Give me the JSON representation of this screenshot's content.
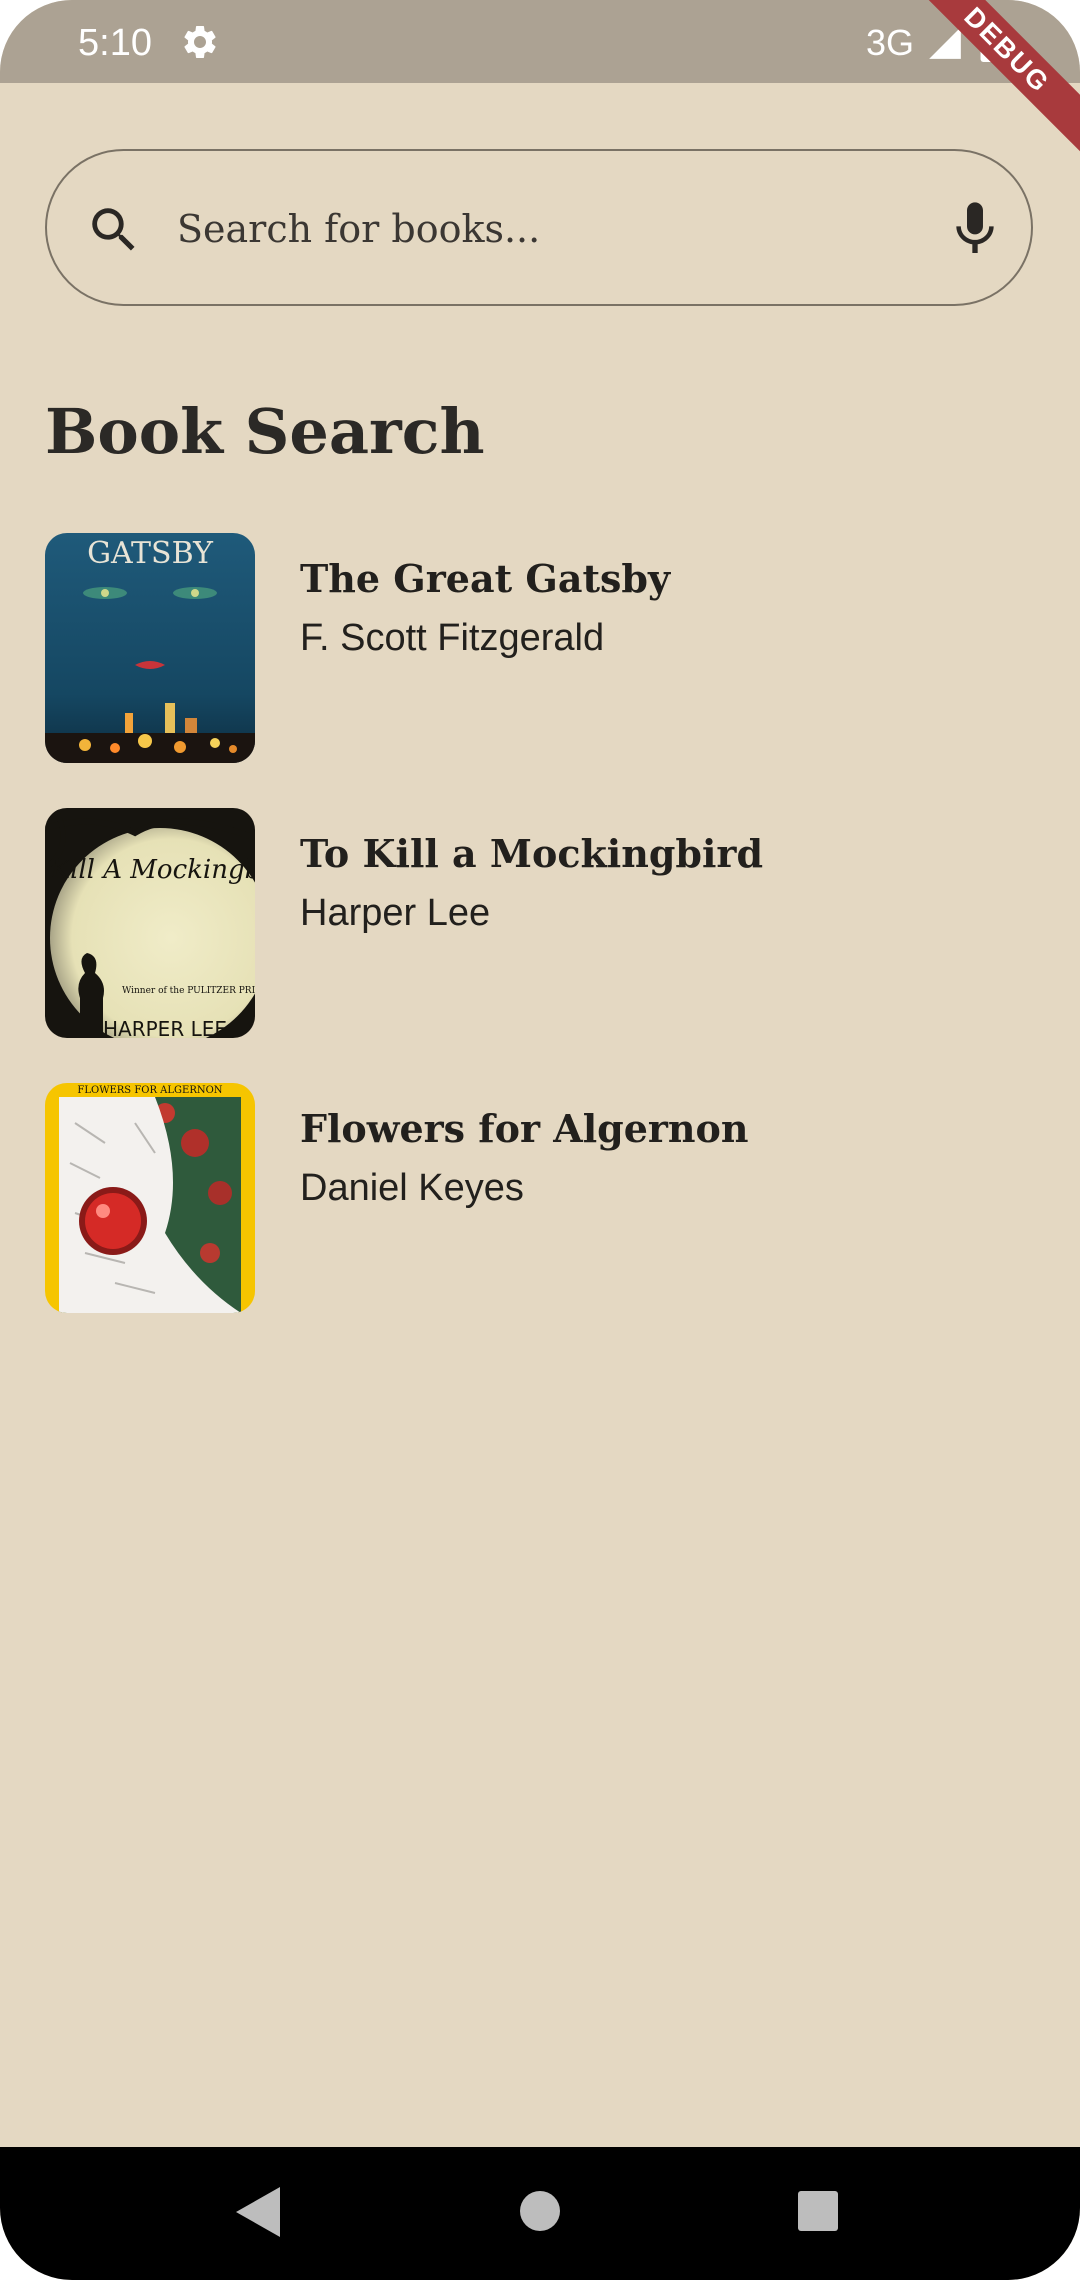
{
  "status_bar": {
    "time": "5:10",
    "network": "3G",
    "icons": [
      "gear-icon",
      "signal-icon",
      "battery-icon"
    ]
  },
  "debug_banner": "DEBUG",
  "search": {
    "placeholder": "Search for books...",
    "value": "",
    "icons": [
      "search-icon",
      "mic-icon"
    ]
  },
  "page": {
    "title": "Book Search"
  },
  "books": [
    {
      "title": "The Great Gatsby",
      "author": "F. Scott Fitzgerald",
      "cover_text": "GATSBY"
    },
    {
      "title": "To Kill a Mockingbird",
      "author": "Harper Lee",
      "cover_text": "To Kill A Mockingbird",
      "cover_subtext": "Winner of the PULITZER PRIZE",
      "cover_author": "HARPER LEE"
    },
    {
      "title": "Flowers for Algernon",
      "author": "Daniel Keyes",
      "cover_text": "FLOWERS FOR ALGERNON"
    }
  ],
  "nav": {
    "icons": [
      "back-icon",
      "home-icon",
      "recents-icon"
    ]
  },
  "colors": {
    "background": "#e4d8c2",
    "status_bar": "#aca293",
    "debug_banner": "#a83a3d",
    "text": "#22201d",
    "nav_bar": "#000000"
  }
}
